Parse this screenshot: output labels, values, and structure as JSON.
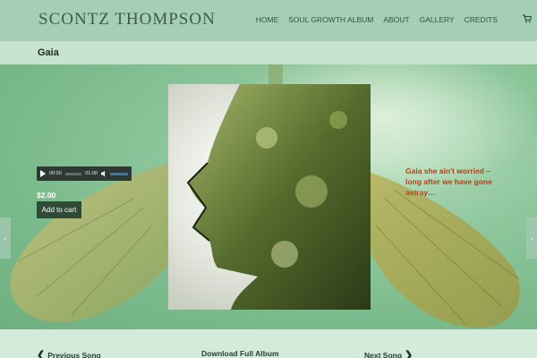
{
  "header": {
    "logo": "SCONTZ THOMPSON",
    "nav": [
      "HOME",
      "SOUL GROWTH ALBUM",
      "ABOUT",
      "GALLERY",
      "CREDITS"
    ],
    "cart_icon": "cart-icon"
  },
  "page": {
    "title": "Gaia"
  },
  "player": {
    "current_time": "00:00",
    "duration": "01:00",
    "progress": 0
  },
  "product": {
    "price": "$2.00",
    "add_to_cart": "Add to cart"
  },
  "lyric": "Gaia she ain't worried – long after we have gone astray…",
  "footer": {
    "prev": "Previous Song",
    "download": "Download Full Album",
    "next": "Next Song"
  },
  "colors": {
    "header_bg": "#a5cfb5",
    "title_bg": "#c6e3d0",
    "lyric": "#b2421a",
    "button": "#2f4a36"
  }
}
